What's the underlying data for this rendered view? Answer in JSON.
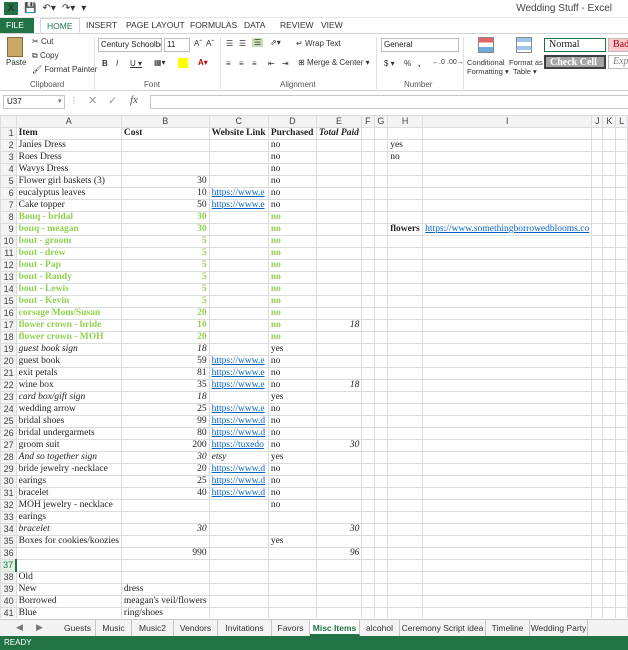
{
  "window": {
    "title": "Wedding Stuff - Excel"
  },
  "ribbon_tabs": [
    "FILE",
    "HOME",
    "INSERT",
    "PAGE LAYOUT",
    "FORMULAS",
    "DATA",
    "REVIEW",
    "VIEW"
  ],
  "clipboard": {
    "cut": "Cut",
    "copy": "Copy",
    "format_painter": "Format Painter",
    "paste": "Paste",
    "label": "Clipboard"
  },
  "font": {
    "name": "Century Schoolbc",
    "size": "11",
    "label": "Font"
  },
  "alignment": {
    "wrap": "Wrap Text",
    "merge": "Merge & Center",
    "label": "Alignment"
  },
  "number": {
    "format": "General",
    "label": "Number",
    "currency": "$",
    "percent": "%",
    "comma": ","
  },
  "styles": {
    "conditional": "Conditional",
    "conditional2": "Formatting",
    "format_as": "Format as",
    "format_as2": "Table",
    "normal": "Normal",
    "bad": "Bad",
    "check": "Check Cell",
    "explanatory": "Exp"
  },
  "formula": {
    "namebox": "U37",
    "fx": "fx",
    "content": ""
  },
  "columns": [
    "A",
    "B",
    "C",
    "D",
    "E",
    "F",
    "G",
    "H",
    "I",
    "J",
    "K",
    "L"
  ],
  "rows": [
    {
      "n": "1",
      "cls": "hdr",
      "A": "Item",
      "B": "Cost",
      "C": "Website Link",
      "D": "Purchased",
      "E": "Total Paid"
    },
    {
      "n": "2",
      "A": "Janies Dress",
      "D": "no",
      "H": "yes"
    },
    {
      "n": "3",
      "A": "Roes Dress",
      "D": "no",
      "H": "no"
    },
    {
      "n": "4",
      "A": "Wavys Dress",
      "D": "no"
    },
    {
      "n": "5",
      "A": "Flower girl baskets (3)",
      "B": "30",
      "D": "no"
    },
    {
      "n": "6",
      "A": "eucalyptus leaves",
      "B": "10",
      "C": "https://www.e",
      "D": "no"
    },
    {
      "n": "7",
      "A": "Cake topper",
      "B": "50",
      "C": "https://www.e",
      "D": "no"
    },
    {
      "n": "8",
      "style": "green",
      "A": "Bouq - bridal",
      "B": "30",
      "D": "no"
    },
    {
      "n": "9",
      "style": "green",
      "A": "bouq - meagan",
      "B": "30",
      "D": "no",
      "H": "flowers",
      "I": "https://www.somethingborrowedblooms.co"
    },
    {
      "n": "10",
      "style": "green",
      "A": "bout - groom",
      "B": "5",
      "D": "no"
    },
    {
      "n": "11",
      "style": "green",
      "A": "bout - drew",
      "B": "5",
      "D": "no"
    },
    {
      "n": "12",
      "style": "green",
      "A": "bout - Pap",
      "B": "5",
      "D": "no"
    },
    {
      "n": "13",
      "style": "green",
      "A": "bout - Randy",
      "B": "5",
      "D": "no"
    },
    {
      "n": "14",
      "style": "green",
      "A": "bout - Lewis",
      "B": "5",
      "D": "no"
    },
    {
      "n": "15",
      "style": "green",
      "A": "bout - Kevin",
      "B": "5",
      "D": "no"
    },
    {
      "n": "16",
      "style": "green",
      "A": "corsage Mom/Susan",
      "B": "20",
      "D": "no"
    },
    {
      "n": "17",
      "style": "green",
      "A": "flower crown - bride",
      "B": "10",
      "D": "no",
      "E": "18"
    },
    {
      "n": "18",
      "style": "green",
      "A": "flower crown - MOH",
      "B": "20",
      "D": "no"
    },
    {
      "n": "19",
      "style": "italic",
      "A": "guest book sign",
      "B": "18",
      "D": "yes"
    },
    {
      "n": "20",
      "A": "guest book",
      "B": "59",
      "C": "https://www.e",
      "D": "no"
    },
    {
      "n": "21",
      "A": "exit petals",
      "B": "81",
      "C": "https://www.e",
      "D": "no"
    },
    {
      "n": "22",
      "A": "wine box",
      "B": "35",
      "C": "https://www.e",
      "D": "no",
      "E": "18"
    },
    {
      "n": "23",
      "style": "italic",
      "A": "card box/gift sign",
      "B": "18",
      "D": "yes"
    },
    {
      "n": "24",
      "A": "wedding arrow",
      "B": "25",
      "C": "https://www.e",
      "D": "no"
    },
    {
      "n": "25",
      "A": "bridal shoes",
      "B": "99",
      "C": "https://www.d",
      "D": "no"
    },
    {
      "n": "26",
      "A": "bridal undergarmets",
      "B": "80",
      "C": "https://www.d",
      "D": "no"
    },
    {
      "n": "27",
      "A": "groom suit",
      "B": "200",
      "C": "https://tuxedo",
      "D": "no",
      "E": "30"
    },
    {
      "n": "28",
      "style": "italic",
      "A": "And so together sign",
      "B": "30",
      "C": "etsy",
      "D": "yes"
    },
    {
      "n": "29",
      "A": "bride jewelry -necklace",
      "B": "20",
      "C": "https://www.d",
      "D": "no"
    },
    {
      "n": "30",
      "A": "earings",
      "B": "25",
      "C": "https://www.d",
      "D": "no"
    },
    {
      "n": "31",
      "A": "bracelet",
      "B": "40",
      "C": "https://www.d",
      "D": "no"
    },
    {
      "n": "32",
      "A": "MOH jewelry - necklace",
      "D": "no"
    },
    {
      "n": "33",
      "A": "earings"
    },
    {
      "n": "34",
      "style": "italic",
      "A": "bracelet",
      "B": "30",
      "E": "30"
    },
    {
      "n": "35",
      "A": "Boxes for cookies/koozies",
      "D": "yes"
    },
    {
      "n": "36",
      "B": "990",
      "E": "96"
    },
    {
      "n": "37",
      "sel": true
    },
    {
      "n": "38",
      "A": "Old"
    },
    {
      "n": "39",
      "A": "New",
      "B": "dress"
    },
    {
      "n": "40",
      "A": "Borrowed",
      "B": "meagan's veil/flowers"
    },
    {
      "n": "41",
      "A": "Blue",
      "B": "ring/shoes"
    },
    {
      "n": "42"
    }
  ],
  "sheets": [
    "Guests",
    "Music",
    "Music2",
    "Vendors",
    "Invitations",
    "Favors",
    "Misc Items",
    "alcohol",
    "Ceremony Script idea",
    "Timeline",
    "Wedding Party"
  ],
  "active_sheet": "Misc Items",
  "status": {
    "text": "READY"
  },
  "colors": {
    "excel_green": "#217346",
    "link": "#0563c1",
    "highlight_green": "#92d050"
  }
}
